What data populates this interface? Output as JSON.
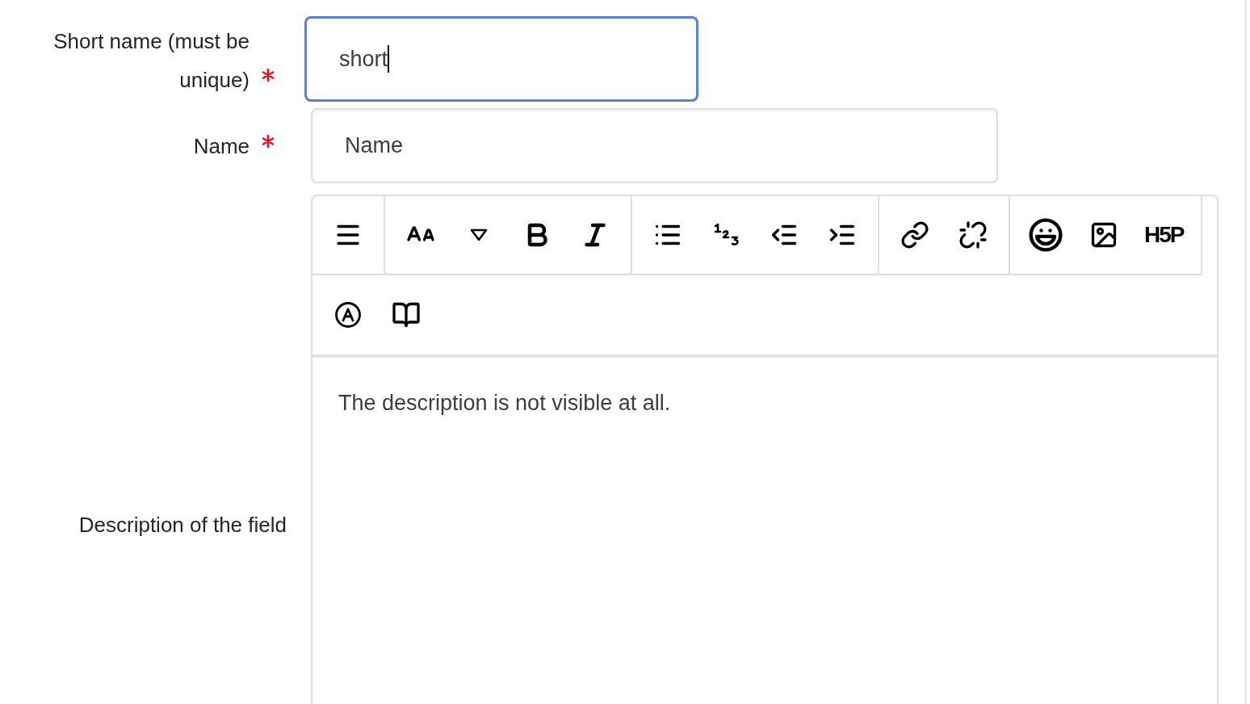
{
  "fields": [
    {
      "kind": "text",
      "label": "Short name (must be unique)",
      "required": true,
      "value": "short",
      "focused": true
    },
    {
      "kind": "text",
      "label": "Name",
      "required": true,
      "value": "Name",
      "focused": false
    },
    {
      "kind": "editor",
      "label": "Description of the field",
      "required": false,
      "value": "The description is not visible at all.",
      "toolbar": [
        [
          [
            {
              "kind": "menu"
            }
          ],
          [
            {
              "kind": "font-size"
            },
            {
              "kind": "dropdown"
            },
            {
              "kind": "bold"
            },
            {
              "kind": "italic"
            }
          ],
          [
            {
              "kind": "bullet-list"
            },
            {
              "kind": "numbered-list"
            },
            {
              "kind": "outdent"
            },
            {
              "kind": "indent"
            }
          ],
          [
            {
              "kind": "link"
            },
            {
              "kind": "unlink"
            }
          ],
          [
            {
              "kind": "emoji"
            },
            {
              "kind": "image"
            },
            {
              "kind": "h5p",
              "label": "H5P"
            }
          ]
        ],
        [
          [
            {
              "kind": "accessibility"
            },
            {
              "kind": "book"
            }
          ]
        ]
      ]
    }
  ]
}
